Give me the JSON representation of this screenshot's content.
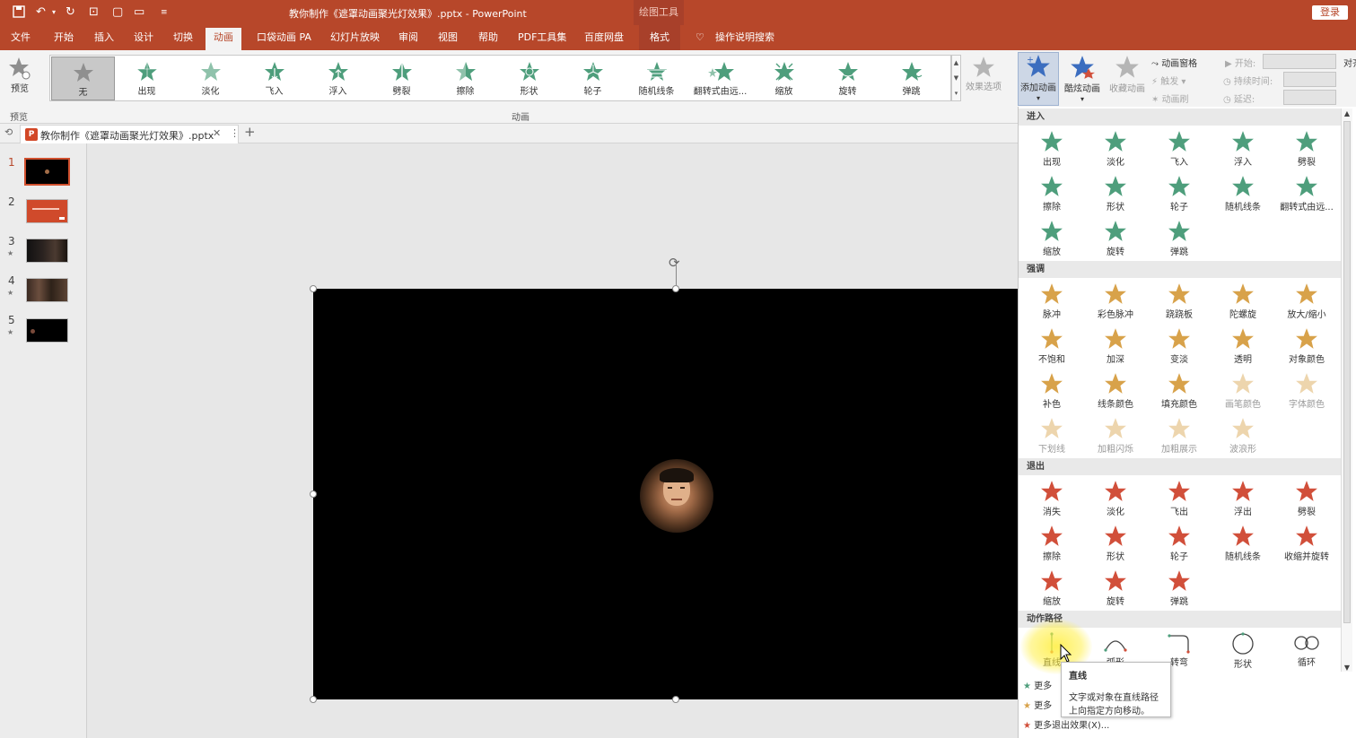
{
  "window": {
    "title": "教你制作《遮罩动画聚光灯效果》.pptx  -  PowerPoint",
    "contextual_tab": "绘图工具",
    "login": "登录"
  },
  "menu": {
    "tabs": [
      "文件",
      "开始",
      "插入",
      "设计",
      "切换",
      "动画",
      "口袋动画 PA",
      "幻灯片放映",
      "审阅",
      "视图",
      "帮助",
      "PDF工具集",
      "百度网盘",
      "格式"
    ],
    "active": "动画",
    "search": "操作说明搜索"
  },
  "ribbon": {
    "preview": "预览",
    "preview_group": "预览",
    "anim_group": "动画",
    "gallery": [
      "无",
      "出现",
      "淡化",
      "飞入",
      "浮入",
      "劈裂",
      "擦除",
      "形状",
      "轮子",
      "随机线条",
      "翻转式由远...",
      "缩放",
      "旋转",
      "弹跳"
    ],
    "effect_options": "效果选项",
    "add_animation": "添加动画",
    "cool_animation": "酷炫动画",
    "fav_animation": "收藏动画",
    "anim_pane": "动画窗格",
    "trigger": "触发",
    "anim_painter": "动画刷",
    "start": "开始:",
    "duration": "持续时间:",
    "delay": "延迟:",
    "align": "对齐"
  },
  "file_tab": {
    "name": "教你制作《遮罩动画聚光灯效果》.pptx"
  },
  "slides": [
    {
      "n": "1",
      "star": ""
    },
    {
      "n": "2",
      "star": ""
    },
    {
      "n": "3",
      "star": "★"
    },
    {
      "n": "4",
      "star": "★"
    },
    {
      "n": "5",
      "star": "★"
    }
  ],
  "colors": {
    "accent": "#b7472a",
    "entrance": "#4e9e7c",
    "emphasis": "#d8a24a",
    "exit": "#d14f3a",
    "path": "#4e9e7c"
  },
  "dropdown": {
    "entrance": {
      "title": "进入",
      "items": [
        "出现",
        "淡化",
        "飞入",
        "浮入",
        "劈裂",
        "擦除",
        "形状",
        "轮子",
        "随机线条",
        "翻转式由远...",
        "缩放",
        "旋转",
        "弹跳"
      ]
    },
    "emphasis": {
      "title": "强调",
      "items": [
        "脉冲",
        "彩色脉冲",
        "跷跷板",
        "陀螺旋",
        "放大/缩小",
        "不饱和",
        "加深",
        "变淡",
        "透明",
        "对象颜色",
        "补色",
        "线条颜色",
        "填充颜色",
        "画笔颜色",
        "字体颜色",
        "下划线",
        "加粗闪烁",
        "加粗展示",
        "波浪形"
      ]
    },
    "exit": {
      "title": "退出",
      "items": [
        "消失",
        "淡化",
        "飞出",
        "浮出",
        "劈裂",
        "擦除",
        "形状",
        "轮子",
        "随机线条",
        "收缩并旋转",
        "缩放",
        "旋转",
        "弹跳"
      ]
    },
    "paths": {
      "title": "动作路径",
      "items": [
        "直线",
        "弧形",
        "转弯",
        "形状",
        "循环"
      ]
    },
    "more": [
      "更多",
      "更多",
      "更多退出效果(X)..."
    ]
  },
  "tooltip": {
    "title": "直线",
    "desc1": "文字或对象在直线路径",
    "desc2": "上向指定方向移动。"
  }
}
